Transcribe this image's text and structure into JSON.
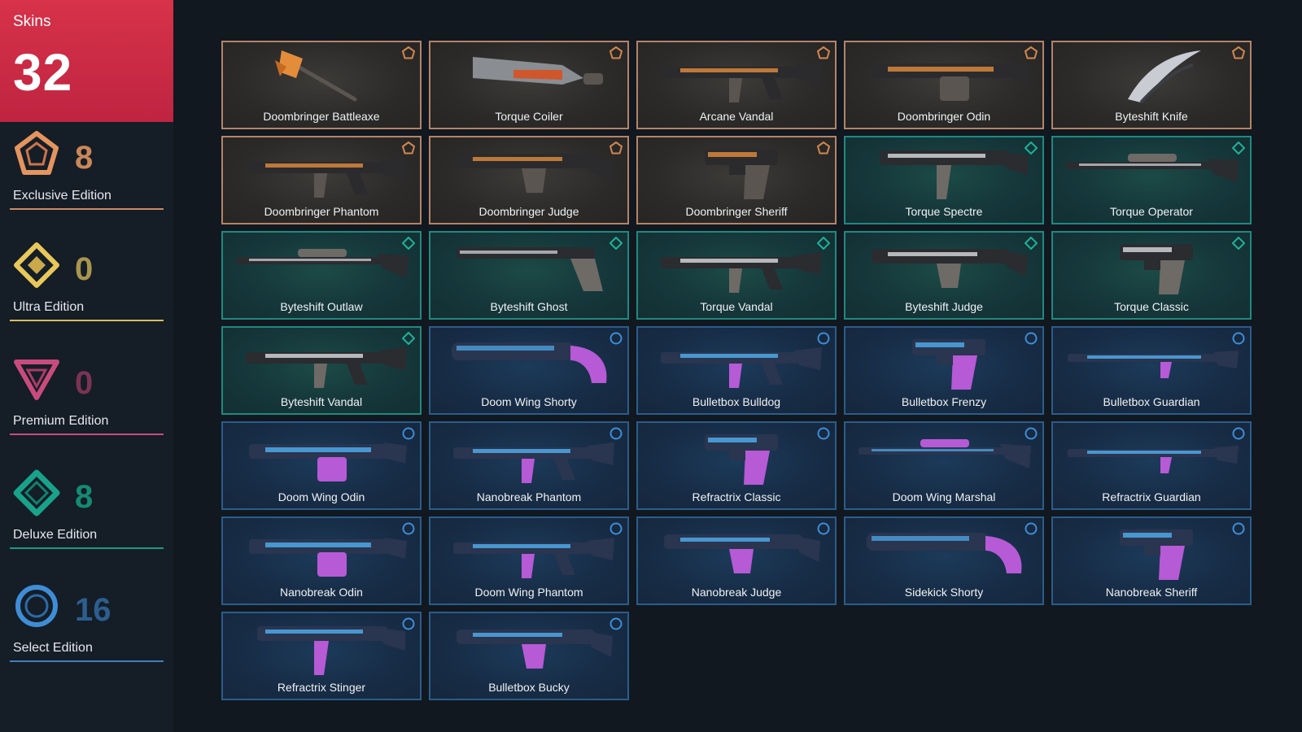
{
  "sidebar": {
    "total_label": "Skins",
    "total_count": "32",
    "tiers": [
      {
        "label": "Exclusive Edition",
        "count": "8",
        "icon": "exclusive-edition-icon",
        "color": "#e4945e"
      },
      {
        "label": "Ultra Edition",
        "count": "0",
        "icon": "ultra-edition-icon",
        "color": "#e8c85a"
      },
      {
        "label": "Premium Edition",
        "count": "0",
        "icon": "premium-edition-icon",
        "color": "#c94b7d"
      },
      {
        "label": "Deluxe Edition",
        "count": "8",
        "icon": "deluxe-edition-icon",
        "color": "#19a28a"
      },
      {
        "label": "Select Edition",
        "count": "16",
        "icon": "select-edition-icon",
        "color": "#3f8dd6"
      }
    ]
  },
  "skins": [
    {
      "name": "Doombringer Battleaxe",
      "tier": "exclusive",
      "weapon": "melee-axe"
    },
    {
      "name": "Torque Coiler",
      "tier": "exclusive",
      "weapon": "melee-blade"
    },
    {
      "name": "Arcane Vandal",
      "tier": "exclusive",
      "weapon": "rifle"
    },
    {
      "name": "Doombringer Odin",
      "tier": "exclusive",
      "weapon": "heavy"
    },
    {
      "name": "Byteshift Knife",
      "tier": "exclusive",
      "weapon": "knife"
    },
    {
      "name": "Doombringer Phantom",
      "tier": "exclusive",
      "weapon": "rifle"
    },
    {
      "name": "Doombringer Judge",
      "tier": "exclusive",
      "weapon": "shotgun"
    },
    {
      "name": "Doombringer Sheriff",
      "tier": "exclusive",
      "weapon": "pistol"
    },
    {
      "name": "Torque Spectre",
      "tier": "deluxe",
      "weapon": "smg"
    },
    {
      "name": "Torque Operator",
      "tier": "deluxe",
      "weapon": "sniper"
    },
    {
      "name": "Byteshift Outlaw",
      "tier": "deluxe",
      "weapon": "sniper"
    },
    {
      "name": "Byteshift Ghost",
      "tier": "deluxe",
      "weapon": "pistol-long"
    },
    {
      "name": "Torque Vandal",
      "tier": "deluxe",
      "weapon": "rifle"
    },
    {
      "name": "Byteshift Judge",
      "tier": "deluxe",
      "weapon": "shotgun"
    },
    {
      "name": "Torque Classic",
      "tier": "deluxe",
      "weapon": "pistol"
    },
    {
      "name": "Byteshift Vandal",
      "tier": "deluxe",
      "weapon": "rifle"
    },
    {
      "name": "Doom Wing Shorty",
      "tier": "select",
      "weapon": "shotgun-short"
    },
    {
      "name": "Bulletbox Bulldog",
      "tier": "select",
      "weapon": "rifle"
    },
    {
      "name": "Bulletbox Frenzy",
      "tier": "select",
      "weapon": "pistol"
    },
    {
      "name": "Bulletbox Guardian",
      "tier": "select",
      "weapon": "rifle-long"
    },
    {
      "name": "Doom Wing Odin",
      "tier": "select",
      "weapon": "heavy"
    },
    {
      "name": "Nanobreak Phantom",
      "tier": "select",
      "weapon": "rifle"
    },
    {
      "name": "Refractrix Classic",
      "tier": "select",
      "weapon": "pistol"
    },
    {
      "name": "Doom Wing Marshal",
      "tier": "select",
      "weapon": "sniper"
    },
    {
      "name": "Refractrix Guardian",
      "tier": "select",
      "weapon": "rifle-long"
    },
    {
      "name": "Nanobreak Odin",
      "tier": "select",
      "weapon": "heavy"
    },
    {
      "name": "Doom Wing Phantom",
      "tier": "select",
      "weapon": "rifle"
    },
    {
      "name": "Nanobreak Judge",
      "tier": "select",
      "weapon": "shotgun"
    },
    {
      "name": "Sidekick Shorty",
      "tier": "select",
      "weapon": "shotgun-short"
    },
    {
      "name": "Nanobreak Sheriff",
      "tier": "select",
      "weapon": "pistol"
    },
    {
      "name": "Refractrix Stinger",
      "tier": "select",
      "weapon": "smg"
    },
    {
      "name": "Bulletbox Bucky",
      "tier": "select",
      "weapon": "shotgun"
    }
  ]
}
